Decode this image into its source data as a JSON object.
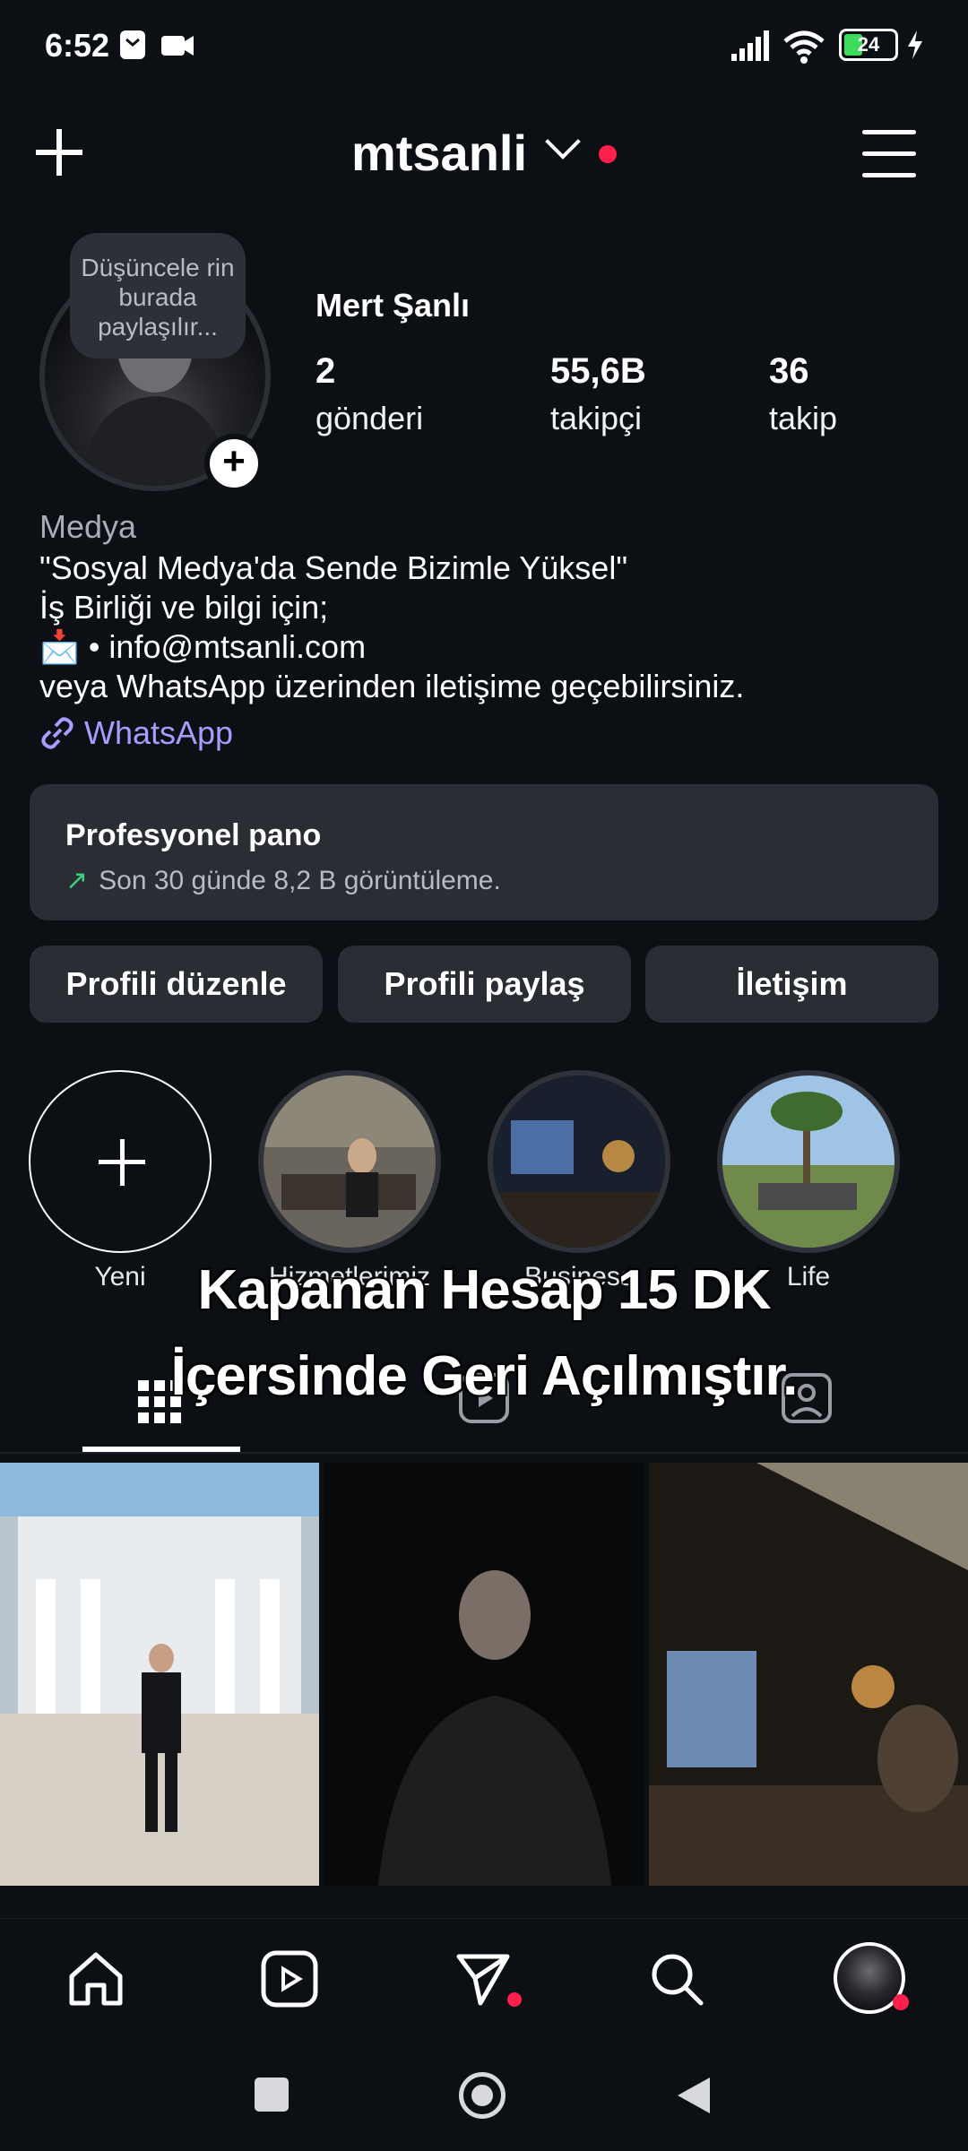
{
  "status_bar": {
    "time": "6:52",
    "battery": "24"
  },
  "header": {
    "username": "mtsanli"
  },
  "profile": {
    "note": "Düşüncele rin burada paylaşılır...",
    "name": "Mert Şanlı",
    "stats": [
      {
        "value": "2",
        "label": "gönderi"
      },
      {
        "value": "55,6B",
        "label": "takipçi"
      },
      {
        "value": "36",
        "label": "takip"
      }
    ],
    "category": "Medya",
    "bio_lines": [
      "\"Sosyal Medya'da Sende Bizimle Yüksel\"",
      "İş Birliği ve bilgi için;",
      "📩 • info@mtsanli.com",
      "veya WhatsApp üzerinden iletişime geçebilirsiniz."
    ],
    "link": "WhatsApp"
  },
  "pro_dashboard": {
    "title": "Profesyonel pano",
    "subtitle": "Son 30 günde 8,2 B görüntüleme."
  },
  "buttons": {
    "edit": "Profili düzenle",
    "share": "Profili paylaş",
    "contact": "İletişim"
  },
  "highlights": [
    {
      "label": "Yeni"
    },
    {
      "label": "Hizmetlerimiz"
    },
    {
      "label": "Business"
    },
    {
      "label": "Life"
    }
  ],
  "caption": {
    "line1": "Kapanan Hesap 15 DK",
    "line2": "İçersinde Geri Açılmıştır."
  },
  "icons": {
    "plus": "plus-icon",
    "menu": "hamburger-icon",
    "home": "home-icon",
    "reels": "reels-icon",
    "messages": "send-icon",
    "search": "search-icon",
    "grid": "grid-icon",
    "tagged": "tagged-icon"
  },
  "colors": {
    "notification_dot": "#ff1f4b",
    "link": "#a89cff",
    "trend_arrow": "#3bd17a"
  }
}
